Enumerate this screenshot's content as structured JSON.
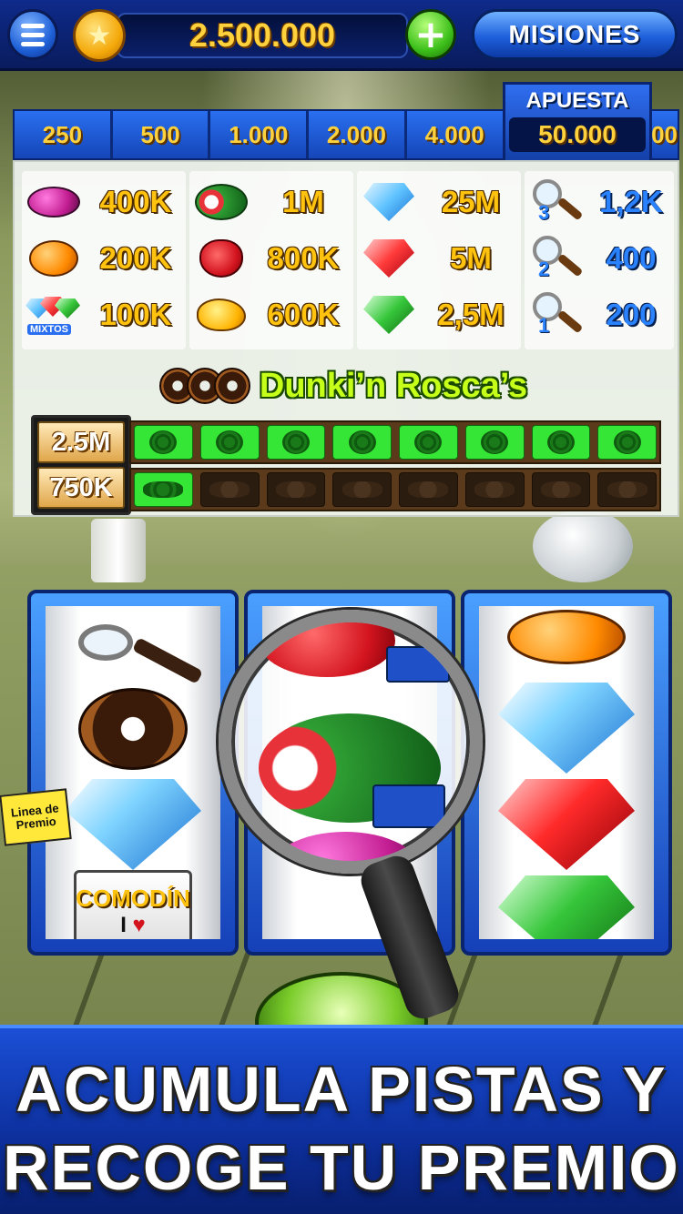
{
  "header": {
    "menu_icon": "menu-icon",
    "coin_icon": "coin-star-icon",
    "balance": "2.500.000",
    "add_icon": "plus-icon",
    "missions_label": "MISIONES"
  },
  "bet": {
    "options": [
      "250",
      "500",
      "1.000",
      "2.000",
      "4.000"
    ],
    "selected_label": "APUESTA",
    "selected_value": "50.000",
    "overflow_fragment": "00"
  },
  "paytable": {
    "col1": [
      {
        "symbol": "plum",
        "payout": "400K"
      },
      {
        "symbol": "orange",
        "payout": "200K"
      },
      {
        "symbol": "mixed-gems",
        "label": "MIXTOS",
        "payout": "100K"
      }
    ],
    "col2": [
      {
        "symbol": "watermelon",
        "payout": "1M"
      },
      {
        "symbol": "strawberry",
        "payout": "800K"
      },
      {
        "symbol": "mango",
        "payout": "600K"
      }
    ],
    "col3": [
      {
        "symbol": "blue-diamond",
        "payout": "25M"
      },
      {
        "symbol": "red-diamond",
        "payout": "5M"
      },
      {
        "symbol": "green-diamond",
        "payout": "2,5M"
      }
    ],
    "col4": [
      {
        "symbol": "magnifier-3",
        "count": "3",
        "payout": "1,2K"
      },
      {
        "symbol": "magnifier-2",
        "count": "2",
        "payout": "400"
      },
      {
        "symbol": "magnifier-1",
        "count": "1",
        "payout": "200"
      }
    ]
  },
  "bonus": {
    "title": "Dunki’n Rosca’s",
    "prize_top": "2.5M",
    "prize_bottom": "750K",
    "fingerprints_total": 8,
    "fingerprints_collected": 8,
    "footprints_total": 8,
    "footprints_collected": 1
  },
  "reels": {
    "reel1": [
      "magnifier",
      "donut",
      "blue-diamond",
      "wild"
    ],
    "reel2": [
      "strawberry",
      "watermelon",
      "plum"
    ],
    "reel3": [
      "orange",
      "blue-diamond",
      "red-diamond",
      "green-diamond"
    ],
    "wild_label": "COMODÍN",
    "wild_text_a": "I",
    "wild_text_b": "♥",
    "payline_tag": "Linea de Premio"
  },
  "banner": {
    "line1": "ACUMULA PISTAS Y",
    "line2": "RECOGE TU PREMIO"
  },
  "colors": {
    "accent_blue": "#1f60dc",
    "gold": "#ffd23d",
    "bonus_green": "#c6ff1a",
    "progress_green": "#36e636"
  }
}
